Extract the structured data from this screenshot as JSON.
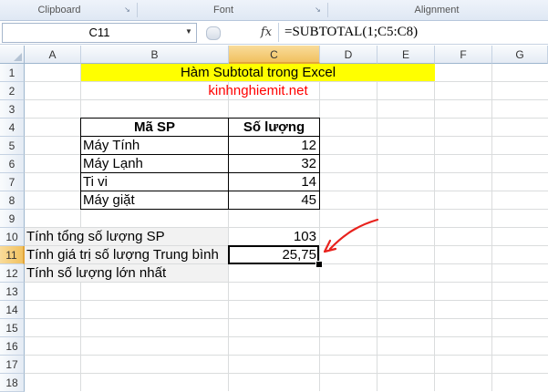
{
  "ribbon": {
    "groups": [
      "Clipboard",
      "Font",
      "Alignment"
    ]
  },
  "formula_bar": {
    "name_box": "C11",
    "fx_label": "fx",
    "formula": "=SUBTOTAL(1;C5:C8)"
  },
  "columns": [
    "A",
    "B",
    "C",
    "D",
    "E",
    "F",
    "G"
  ],
  "rows": [
    "1",
    "2",
    "3",
    "4",
    "5",
    "6",
    "7",
    "8",
    "9",
    "10",
    "11",
    "12",
    "13",
    "14",
    "15",
    "16",
    "17",
    "18"
  ],
  "sheet": {
    "title": "Hàm Subtotal  trong Excel",
    "site": "kinhnghiemit.net",
    "table": {
      "headers": [
        "Mã SP",
        "Số lượng"
      ],
      "rows": [
        {
          "name": "Máy Tính",
          "qty": "12"
        },
        {
          "name": "Máy Lạnh",
          "qty": "32"
        },
        {
          "name": "Ti vi",
          "qty": "14"
        },
        {
          "name": "Máy giặt",
          "qty": "45"
        }
      ]
    },
    "summary": [
      {
        "label": "Tính tổng số lượng SP",
        "value": "103"
      },
      {
        "label": "Tính giá trị số lượng Trung bình",
        "value": "25,75"
      },
      {
        "label": "Tính số lượng lớn nhất",
        "value": ""
      }
    ]
  },
  "colors": {
    "title_band": "#ffff00",
    "site_text": "#ff0000",
    "selection_header": "#f1c15f",
    "annotation_arrow": "#e8221d"
  }
}
